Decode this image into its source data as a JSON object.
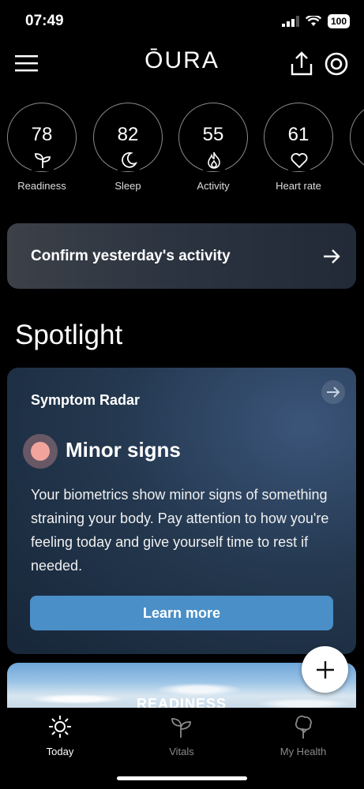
{
  "status_bar": {
    "time": "07:49",
    "battery": "100"
  },
  "header": {
    "brand": "ŌURA",
    "icons": [
      "menu-icon",
      "share-icon",
      "ring-icon"
    ]
  },
  "scores": [
    {
      "value": "78",
      "label": "Readiness",
      "icon": "sprout-icon"
    },
    {
      "value": "82",
      "label": "Sleep",
      "icon": "moon-icon"
    },
    {
      "value": "55",
      "label": "Activity",
      "icon": "flame-icon"
    },
    {
      "value": "61",
      "label": "Heart rate",
      "icon": "heart-icon"
    }
  ],
  "confirm_card": {
    "text": "Confirm yesterday's activity",
    "icon": "arrow-right-icon"
  },
  "spotlight": {
    "section_title": "Spotlight",
    "card_title": "Symptom Radar",
    "heading": "Minor signs",
    "body": "Your biometrics show minor signs of something straining your body. Pay attention to how you're feeling today and give yourself time to rest if needed.",
    "button": "Learn more",
    "dot_color": "#f2a49c"
  },
  "next_card": {
    "label": "READINESS"
  },
  "fab": {
    "icon": "plus-icon"
  },
  "tabbar": {
    "tabs": [
      {
        "label": "Today",
        "icon": "sun-icon",
        "active": true
      },
      {
        "label": "Vitals",
        "icon": "sprout-icon",
        "active": false
      },
      {
        "label": "My Health",
        "icon": "tree-icon",
        "active": false
      }
    ]
  }
}
